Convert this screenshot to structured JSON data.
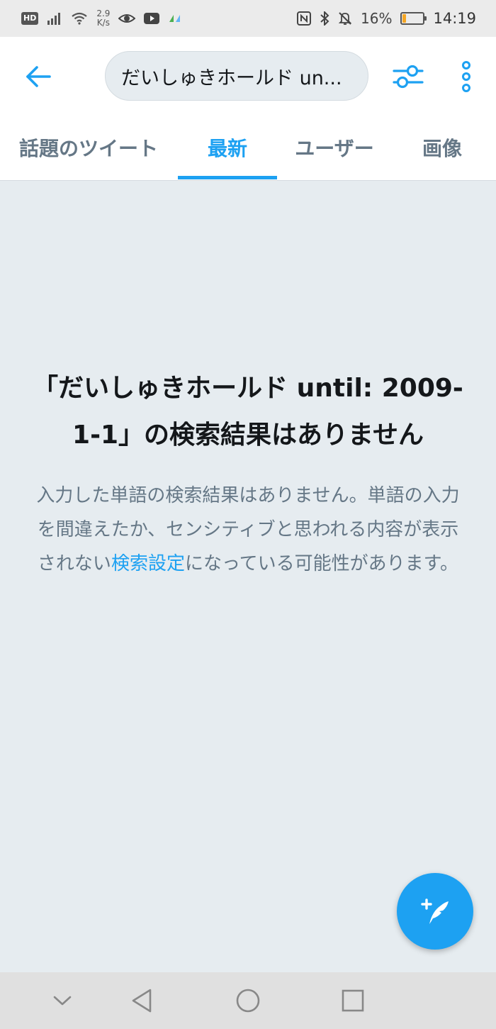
{
  "status_bar": {
    "hd_label": "HD",
    "net_speed_value": "2.9",
    "net_speed_unit": "K/s",
    "battery_percent": "16%",
    "battery_level": 0.16,
    "time": "14:19"
  },
  "header": {
    "search_query": "だいしゅきホールド un..."
  },
  "tabs": [
    {
      "label": "話題のツイート",
      "active": false
    },
    {
      "label": "最新",
      "active": true
    },
    {
      "label": "ユーザー",
      "active": false
    },
    {
      "label": "画像",
      "active": false
    }
  ],
  "empty_state": {
    "title": "「だいしゅきホールド until: 2009-1-1」の検索結果はありません",
    "body_before": "入力した単語の検索結果はありません。単語の入力を間違えたか、センシティブと思われる内容が表示されない",
    "link_text": "検索設定",
    "body_after": "になっている可能性があります。"
  },
  "colors": {
    "accent": "#1da1f2",
    "background": "#e6ecf0",
    "secondary_text": "#657786",
    "primary_text": "#14171a"
  },
  "icons": {
    "back": "arrow-left-icon",
    "filter": "sliders-icon",
    "more": "vertical-dots-icon",
    "compose": "compose-quill-icon",
    "nav_down": "chevron-down-icon",
    "nav_back": "triangle-back-icon",
    "nav_home": "circle-home-icon",
    "nav_recents": "square-recents-icon"
  }
}
